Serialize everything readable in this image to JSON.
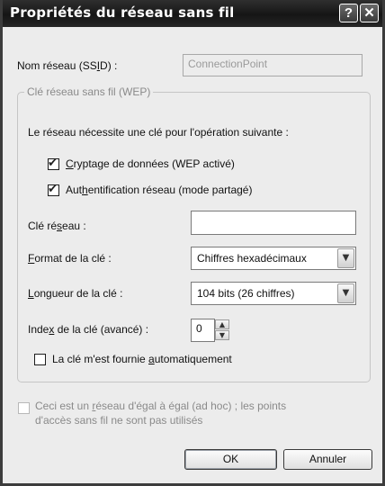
{
  "window": {
    "title": "Propriétés du réseau sans fil",
    "help_glyph": "?",
    "close_glyph": "✕"
  },
  "ssid": {
    "label_pre": "Nom réseau (SS",
    "label_key": "I",
    "label_post": "D) :",
    "value": "ConnectionPoint"
  },
  "wep_group": {
    "legend": "Clé réseau sans fil (WEP)",
    "intro": "Le réseau nécessite une clé pour l'opération suivante :",
    "encryption": {
      "key": "C",
      "label": "ryptage de données (WEP activé)",
      "checked": true
    },
    "auth": {
      "label_pre": "Aut",
      "key": "h",
      "label_post": "entification réseau (mode partagé)",
      "checked": true
    },
    "network_key": {
      "label_pre": "Clé ré",
      "key": "s",
      "label_post": "eau :",
      "value": ""
    },
    "key_format": {
      "key": "F",
      "label_post": "ormat de la clé :",
      "value": "Chiffres hexadécimaux"
    },
    "key_length": {
      "key": "L",
      "label_post": "ongueur de la clé :",
      "value": "104 bits (26 chiffres)"
    },
    "key_index": {
      "label_pre": "Inde",
      "key": "x",
      "label_post": " de la clé (avancé) :",
      "value": "0"
    },
    "auto_key": {
      "label_pre": "La clé m'est fournie ",
      "key": "a",
      "label_post": "utomatiquement",
      "checked": false
    }
  },
  "adhoc": {
    "line1_pre": "Ceci est un ",
    "line1_key": "r",
    "line1_post": "éseau d'égal à égal (ad hoc) ; les points",
    "line2": "d'accès sans fil ne sont pas utilisés",
    "checked": false
  },
  "buttons": {
    "ok": "OK",
    "cancel": "Annuler"
  },
  "glyphs": {
    "check": "✔",
    "dropdown": "▼",
    "spin_up": "▲",
    "spin_down": "▼"
  },
  "icons": {
    "help": "help-icon",
    "close": "close-icon",
    "dropdown": "chevron-down-icon"
  },
  "colors": {
    "titlebar": "#1c1c1c",
    "dialog_bg": "#ececec",
    "disabled_text": "#8a8a8a"
  }
}
